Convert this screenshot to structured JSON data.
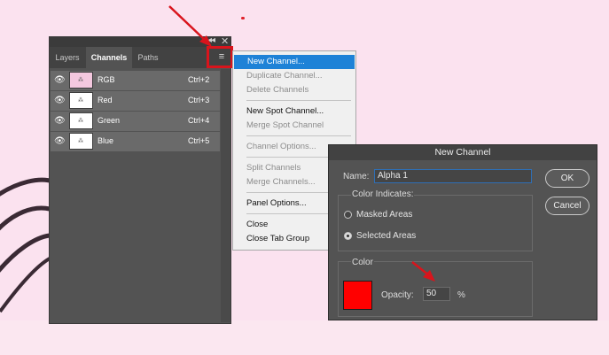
{
  "panel": {
    "tabs": [
      "Layers",
      "Channels",
      "Paths"
    ],
    "active_tab": "Channels",
    "collapse_glyph": "◂◂",
    "close_glyph": "✕",
    "menu_glyph": "≡",
    "channels": [
      {
        "name": "RGB",
        "shortcut": "Ctrl+2"
      },
      {
        "name": "Red",
        "shortcut": "Ctrl+3"
      },
      {
        "name": "Green",
        "shortcut": "Ctrl+4"
      },
      {
        "name": "Blue",
        "shortcut": "Ctrl+5"
      }
    ],
    "icons": {
      "visibility": "eye-icon",
      "thumbnail": "channel-thumbnail-icon"
    }
  },
  "menu": {
    "items": [
      {
        "label": "New Channel...",
        "state": "highlighted"
      },
      {
        "label": "Duplicate Channel...",
        "state": "disabled"
      },
      {
        "label": "Delete Channels",
        "state": "disabled"
      },
      {
        "label": "New Spot Channel...",
        "state": "enabled"
      },
      {
        "label": "Merge Spot Channel",
        "state": "disabled"
      },
      {
        "label": "Channel Options...",
        "state": "disabled"
      },
      {
        "label": "Split Channels",
        "state": "disabled"
      },
      {
        "label": "Merge Channels...",
        "state": "disabled"
      },
      {
        "label": "Panel Options...",
        "state": "enabled"
      },
      {
        "label": "Close",
        "state": "enabled"
      },
      {
        "label": "Close Tab Group",
        "state": "enabled"
      }
    ]
  },
  "dialog": {
    "title": "New Channel",
    "name_label": "Name:",
    "name_value": "Alpha 1",
    "color_indicates_title": "Color Indicates:",
    "options": [
      {
        "label": "Masked Areas",
        "checked": false
      },
      {
        "label": "Selected Areas",
        "checked": true
      }
    ],
    "color_title": "Color",
    "swatch_color": "#ff0000",
    "opacity_label": "Opacity:",
    "opacity_value": "50",
    "percent": "%",
    "ok_label": "OK",
    "cancel_label": "Cancel"
  },
  "colors": {
    "annotation_red": "#d9141c",
    "menu_highlight": "#1e82d7",
    "panel_bg": "#535353",
    "page_bg": "#fbe2ef"
  }
}
